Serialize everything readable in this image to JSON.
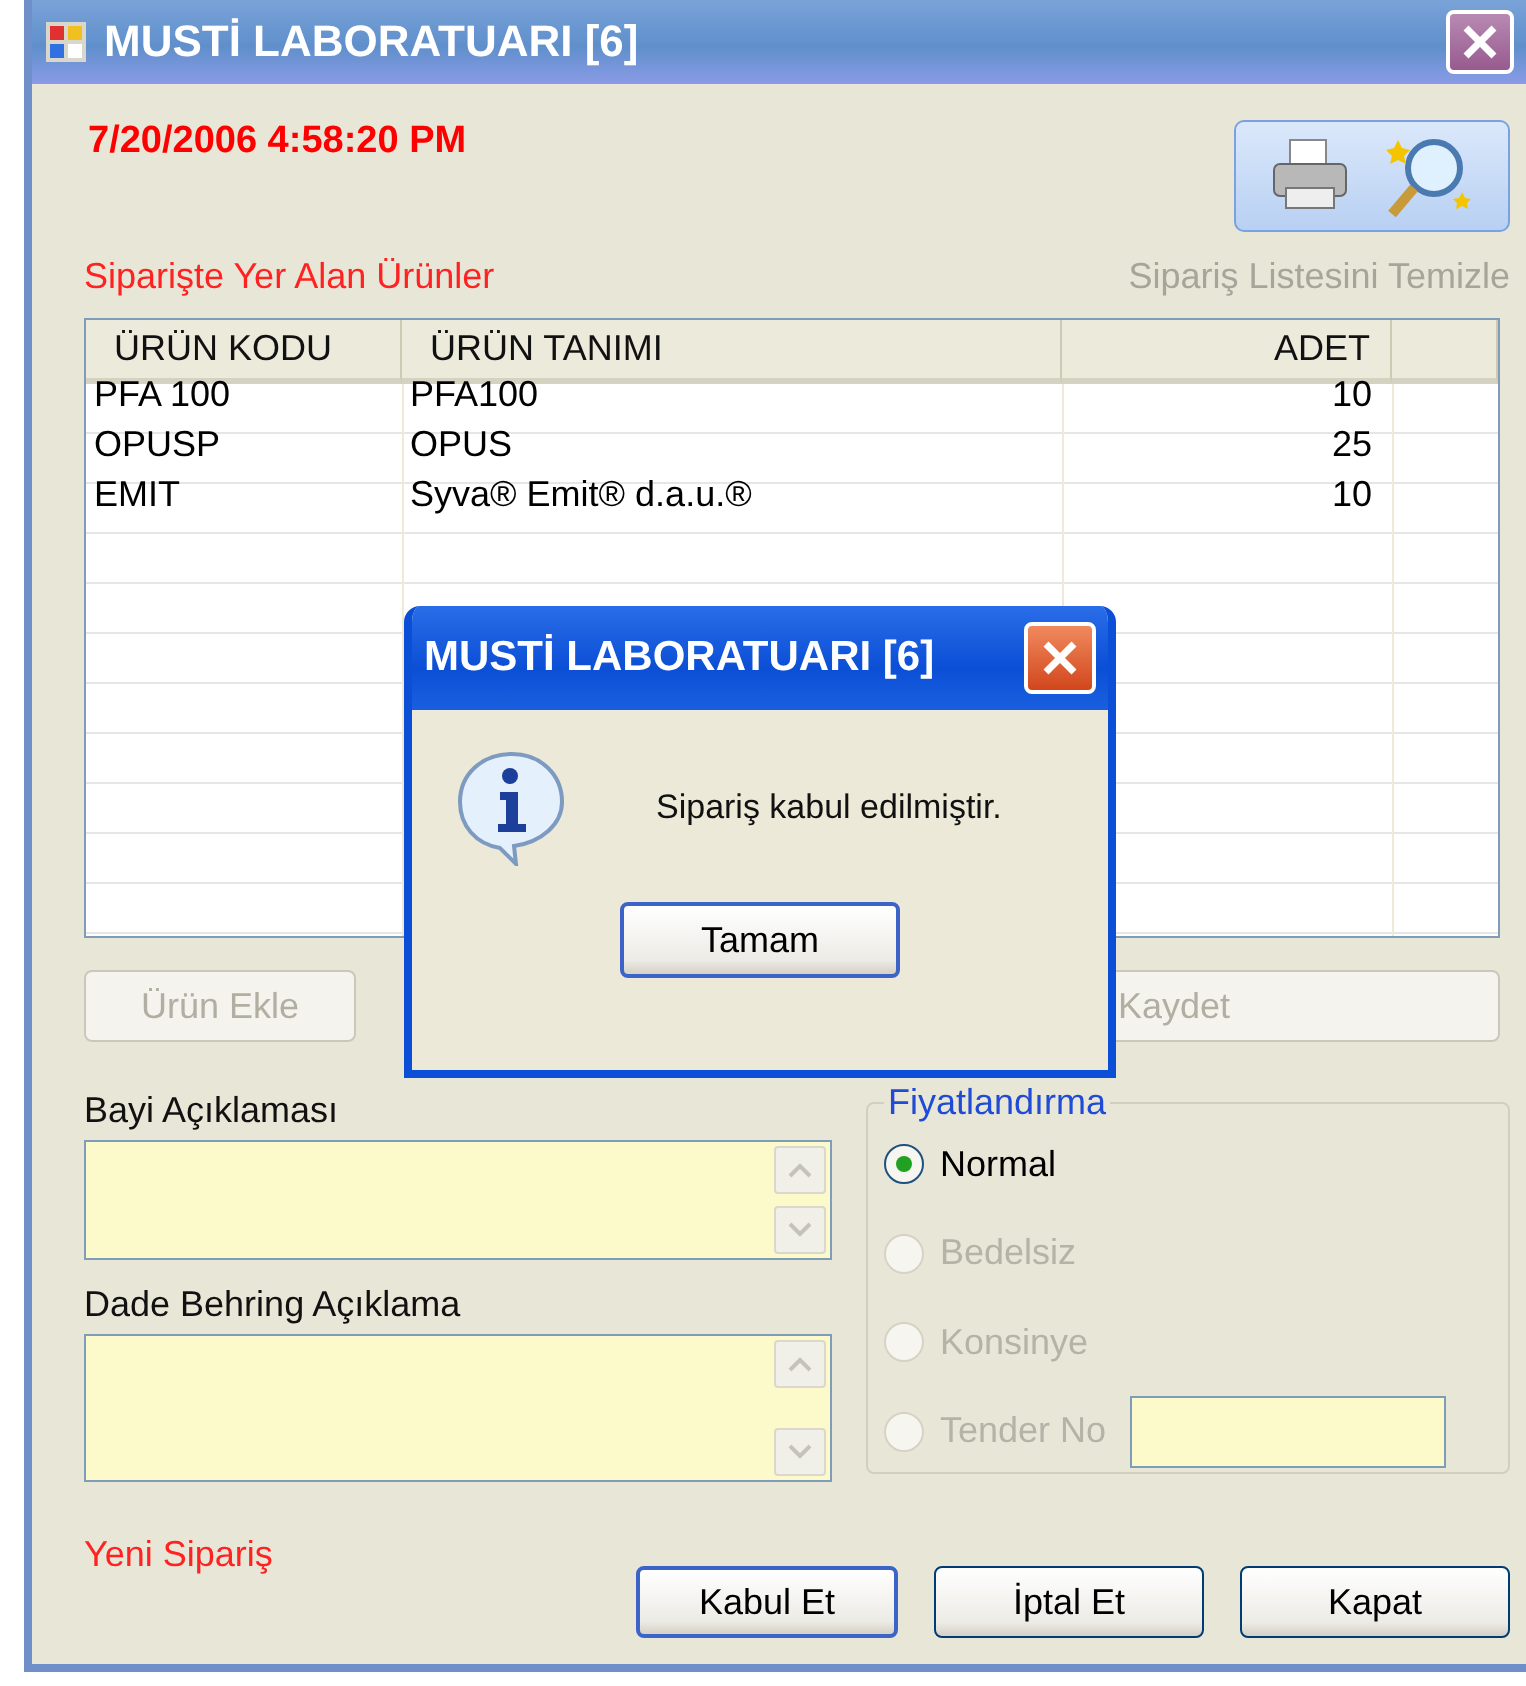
{
  "window": {
    "title": "MUSTİ LABORATUARI [6]"
  },
  "timestamp": "7/20/2006 4:58:20 PM",
  "products_label": "Siparişte Yer Alan Ürünler",
  "clear_link": {
    "label": "Sipariş Listesini Temizle",
    "disabled": true
  },
  "table": {
    "columns": [
      "ÜRÜN KODU",
      "ÜRÜN TANIMI",
      "ADET"
    ],
    "rows": [
      {
        "code": "PFA 100",
        "description": "PFA100",
        "quantity": "10"
      },
      {
        "code": "OPUSP",
        "description": "OPUS",
        "quantity": "25"
      },
      {
        "code": "EMIT",
        "description": "Syva® Emit® d.a.u.®",
        "quantity": "10"
      }
    ]
  },
  "add_button": {
    "label": "Ürün Ekle",
    "disabled": true
  },
  "save_button": {
    "label": "Kaydet",
    "disabled": true
  },
  "notes": [
    {
      "label": "Bayi Açıklaması"
    },
    {
      "label": "Dade Behring Açıklama"
    }
  ],
  "pricing": {
    "title": "Fiyatlandırma",
    "options": [
      {
        "label": "Normal",
        "selected": true,
        "disabled": false,
        "kind": "plain"
      },
      {
        "label": "Bedelsiz",
        "selected": false,
        "disabled": true,
        "kind": "plain"
      },
      {
        "label": "Konsinye",
        "selected": false,
        "disabled": true,
        "kind": "plain"
      },
      {
        "label": "Tender No",
        "selected": false,
        "disabled": true,
        "kind": "field"
      }
    ]
  },
  "status": "Yeni Sipariş",
  "buttons": [
    {
      "label": "Kabul Et",
      "default": true
    },
    {
      "label": "İptal Et",
      "default": false
    },
    {
      "label": "Kapat",
      "default": false
    }
  ],
  "dialog": {
    "title": "MUSTİ LABORATUARI [6]",
    "message": "Sipariş kabul edilmiştir.",
    "button": "Tamam"
  }
}
